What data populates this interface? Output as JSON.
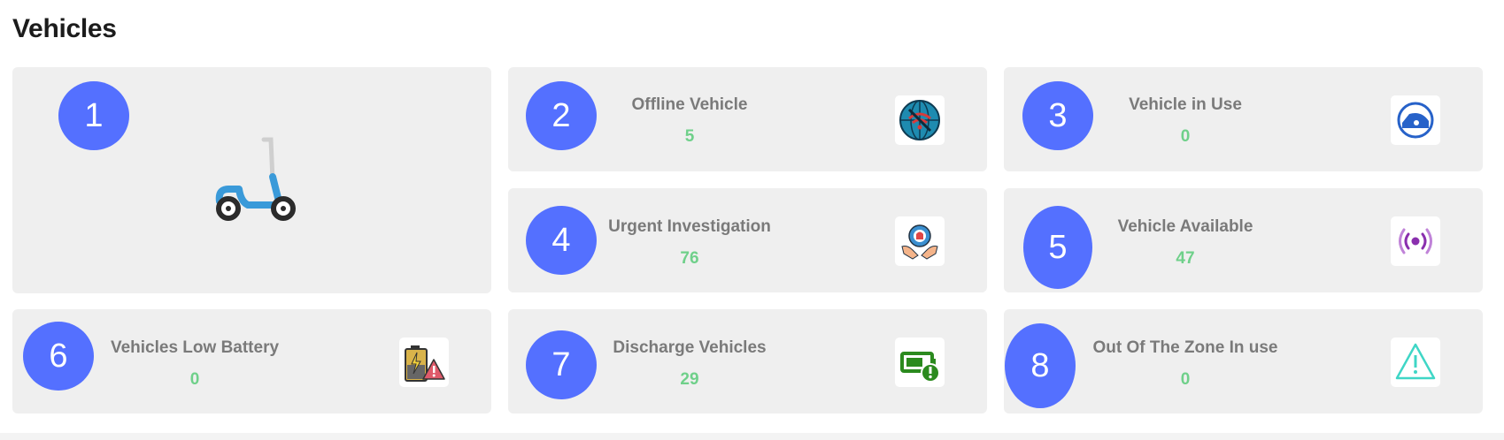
{
  "page": {
    "title": "Vehicles"
  },
  "cards": {
    "c1": {
      "badge": "1",
      "image": "scooter-illustration"
    },
    "c2": {
      "badge": "2",
      "label": "Offline Vehicle",
      "value": "5",
      "icon": "wifi-off-globe-icon"
    },
    "c3": {
      "badge": "3",
      "label": "Vehicle in Use",
      "value": "0",
      "icon": "vehicle-in-use-icon"
    },
    "c4": {
      "badge": "4",
      "label": "Urgent Investigation",
      "value": "76",
      "icon": "siren-gear-hands-icon"
    },
    "c5": {
      "badge": "5",
      "label": "Vehicle Available",
      "value": "47",
      "icon": "signal-broadcast-icon"
    },
    "c6": {
      "badge": "6",
      "label": "Vehicles Low Battery",
      "value": "0",
      "icon": "battery-warning-icon"
    },
    "c7": {
      "badge": "7",
      "label": "Discharge Vehicles",
      "value": "29",
      "icon": "battery-alert-icon"
    },
    "c8": {
      "badge": "8",
      "label": "Out Of The Zone In use",
      "value": "0",
      "icon": "warning-triangle-icon"
    }
  },
  "colors": {
    "badge": "#5470ff",
    "card_bg": "#efefef",
    "label": "#7a7a7a",
    "value": "#6fd08a"
  }
}
